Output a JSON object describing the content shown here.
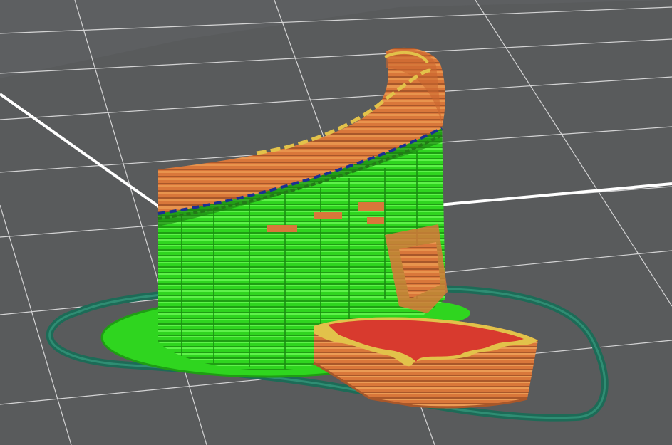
{
  "viewer": {
    "mode": "layer-preview",
    "background_color": "#5d5f61",
    "bed_color": "#5a5c5e",
    "grid_color": "#e8e8e8",
    "axis_color": "#ffffff"
  },
  "model": {
    "icons": [
      "cylinder-print-icon",
      "base-plate-icon"
    ],
    "colors": {
      "perimeter": "#d9773a",
      "perimeter_shadow": "#a8572a",
      "infill_highlight": "#e2c24a",
      "support": "#2fd51f",
      "support_dark": "#1f9d14",
      "top_surface": "#d83a2e",
      "overhang": "#1b2f93",
      "skirt": "#1d6b57",
      "skirt_highlight": "#2f8d73"
    }
  }
}
